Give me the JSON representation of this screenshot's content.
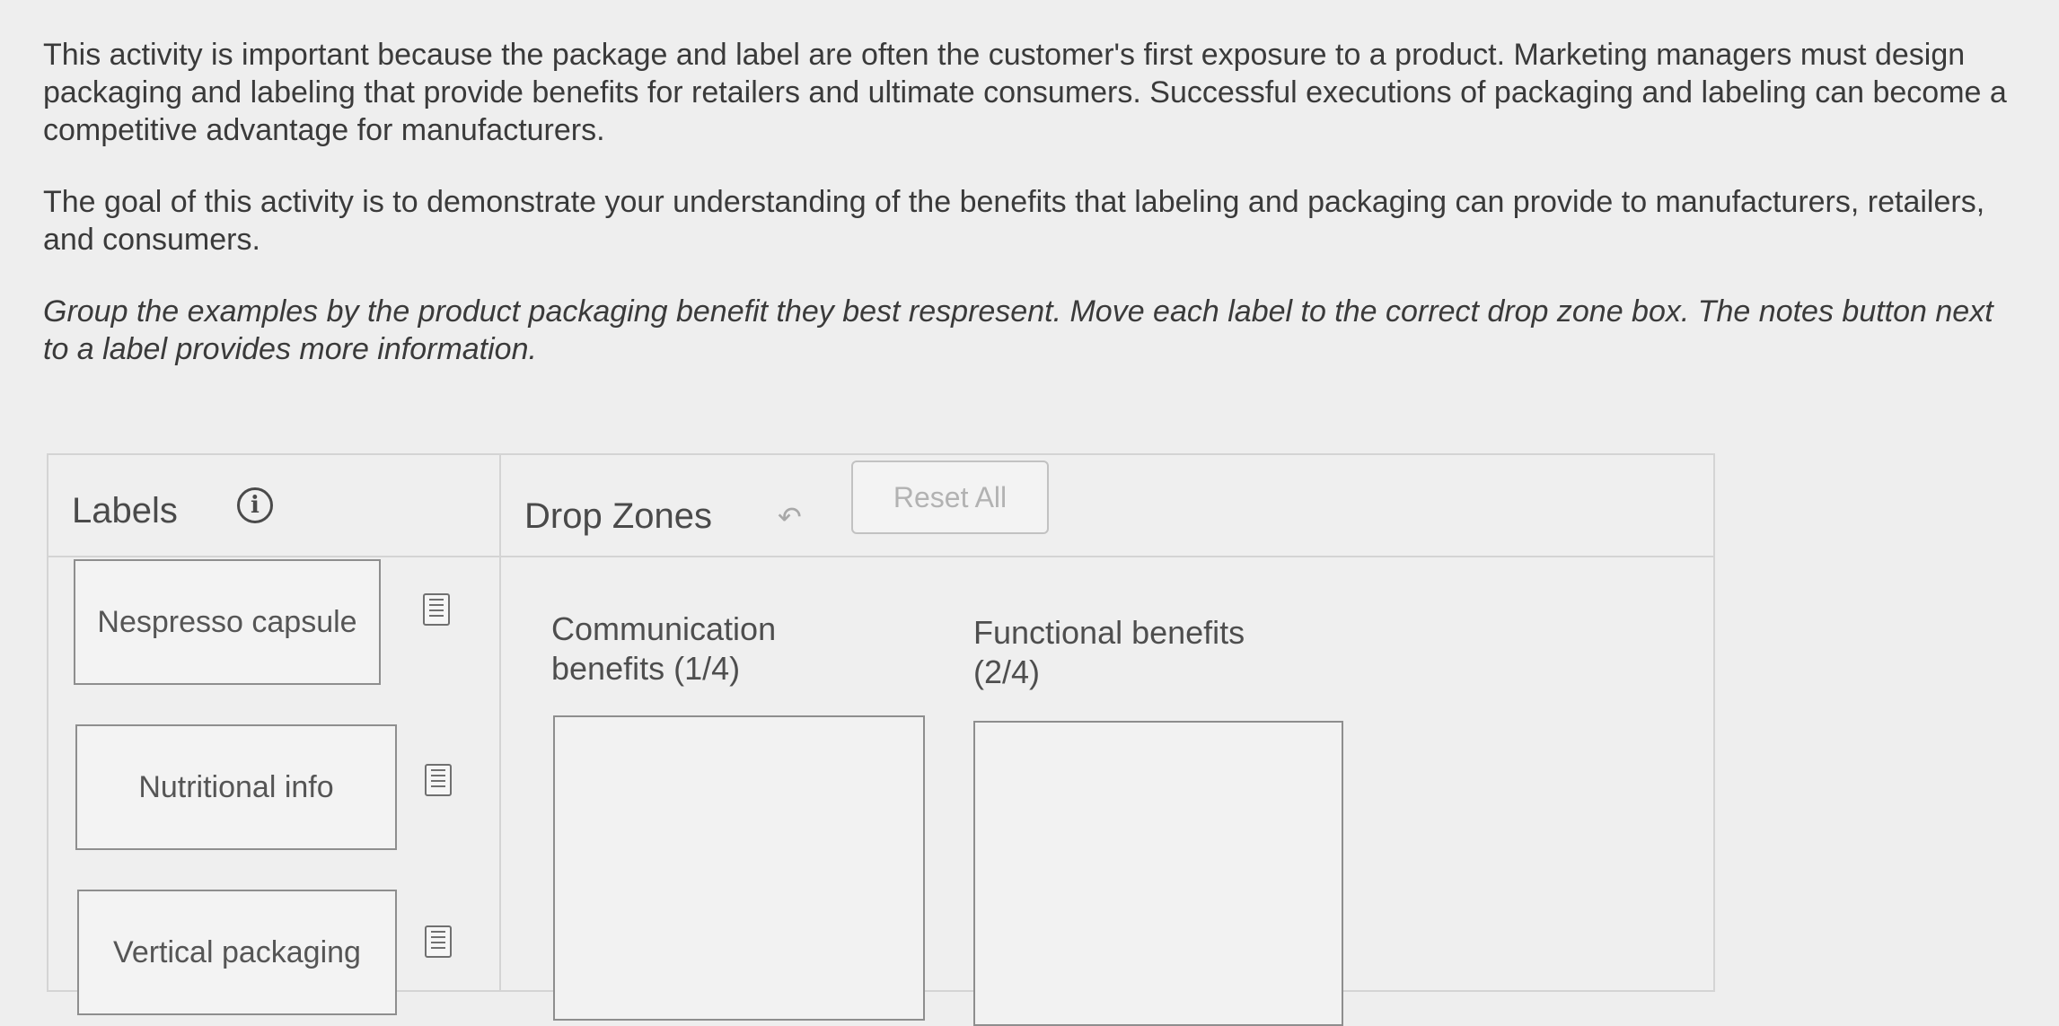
{
  "intro": {
    "paragraph1": "This activity is important because the package and label are often the customer's first exposure to a product. Marketing managers must design packaging and labeling that provide benefits for retailers and ultimate consumers. Successful executions of packaging and labeling can become a competitive advantage for manufacturers.",
    "paragraph2": "The goal of this activity is to demonstrate your understanding of the benefits that labeling and packaging can provide to manufacturers, retailers, and consumers.",
    "instructions": "Group the examples by the product packaging benefit they best respresent. Move each label to the correct drop zone box. The notes button next to a label provides more information."
  },
  "activity": {
    "labels_heading": "Labels",
    "info_icon": "info-icon",
    "info_glyph": "i",
    "dropzones_heading": "Drop Zones",
    "undo_icon": "undo-arrow-icon",
    "undo_glyph": "↶",
    "reset_label": "Reset All",
    "labels": [
      {
        "text": "Nespresso capsule",
        "notes_icon": "notes-icon"
      },
      {
        "text": "Nutritional info",
        "notes_icon": "notes-icon"
      },
      {
        "text": "Vertical packaging",
        "notes_icon": "notes-icon"
      }
    ],
    "zones": [
      {
        "title": "Communication benefits (1/4)"
      },
      {
        "title": "Functional benefits (2/4)"
      }
    ]
  },
  "colors": {
    "background": "#eeeeee",
    "text": "#333333",
    "border": "#8e8e8e",
    "muted": "#b2b2b2"
  }
}
